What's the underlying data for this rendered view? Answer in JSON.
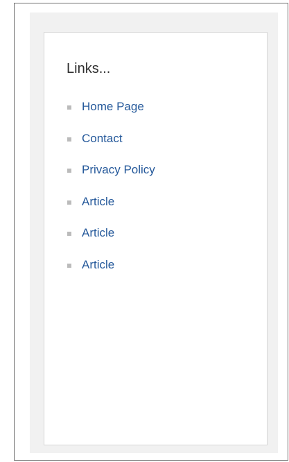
{
  "widget": {
    "title": "Links...",
    "bullet_color": "#bbbbbb",
    "link_color": "#24589a",
    "links": [
      {
        "label": "Home Page",
        "icon": "square-bullet-icon"
      },
      {
        "label": "Contact",
        "icon": "square-bullet-icon"
      },
      {
        "label": "Privacy Policy",
        "icon": "square-bullet-icon"
      },
      {
        "label": "Article",
        "icon": "square-bullet-icon"
      },
      {
        "label": "Article",
        "icon": "square-bullet-icon"
      },
      {
        "label": "Article",
        "icon": "square-bullet-icon"
      }
    ]
  }
}
